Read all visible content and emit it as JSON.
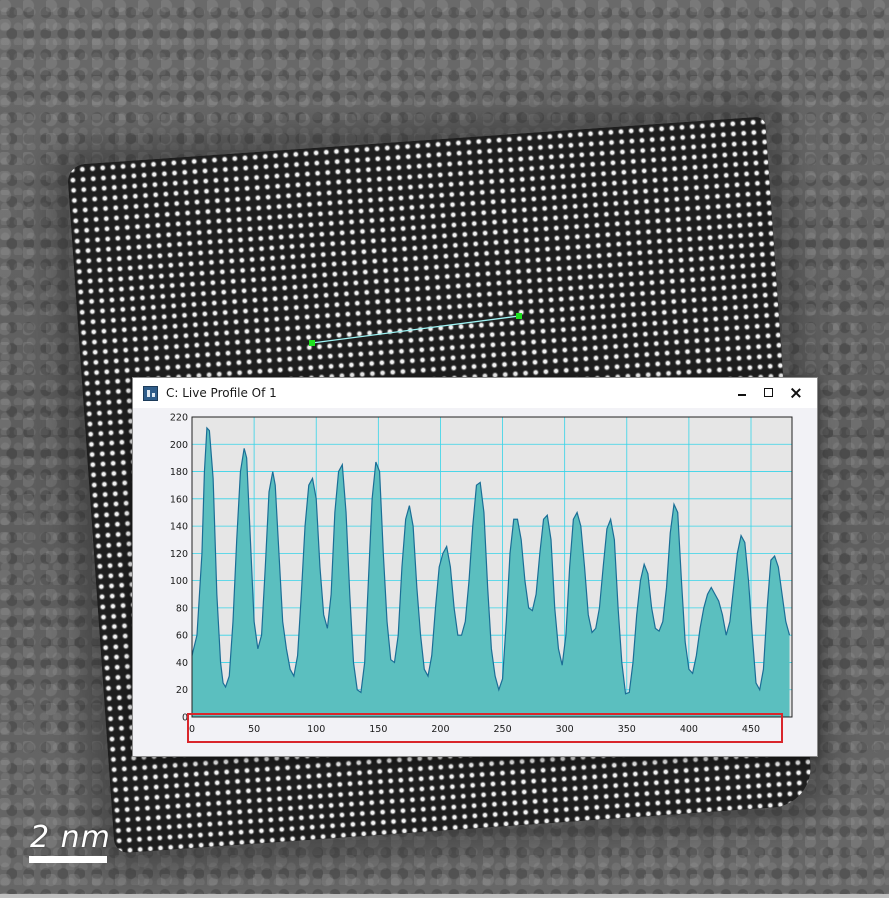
{
  "window": {
    "title": "C: Live Profile Of 1",
    "icon": "profile-app-icon"
  },
  "controls": {
    "minimize_icon": "minimize-icon",
    "maximize_icon": "maximize-icon",
    "close_icon": "close-icon"
  },
  "scale_bar": {
    "label": "2 nm"
  },
  "colors": {
    "fill": "#5bbfbf",
    "stroke": "#1b6e96",
    "grid": "#35d4e8",
    "plot_bg": "#e6e6e6",
    "highlight": "#d9262b",
    "line_endpoint": "#1ee01e",
    "profile_line": "#9ef2f2"
  },
  "chart_data": {
    "type": "area",
    "title": "",
    "xlabel": "",
    "ylabel": "",
    "xlim": [
      0,
      483
    ],
    "ylim": [
      0,
      220
    ],
    "x_ticks": [
      0,
      50,
      100,
      150,
      200,
      250,
      300,
      350,
      400,
      450
    ],
    "y_ticks": [
      0,
      20,
      40,
      60,
      80,
      100,
      120,
      140,
      160,
      180,
      200,
      220
    ],
    "grid": true,
    "x": [
      0,
      4,
      8,
      10,
      12,
      14,
      17,
      20,
      23,
      25,
      27,
      30,
      33,
      36,
      39,
      42,
      44,
      47,
      50,
      53,
      56,
      59,
      62,
      65,
      67,
      70,
      73,
      76,
      79,
      82,
      85,
      88,
      91,
      94,
      97,
      100,
      103,
      106,
      109,
      112,
      115,
      118,
      121,
      124,
      127,
      130,
      133,
      136,
      139,
      142,
      145,
      148,
      151,
      154,
      157,
      160,
      163,
      166,
      169,
      172,
      175,
      178,
      181,
      184,
      187,
      190,
      193,
      196,
      199,
      202,
      205,
      208,
      211,
      214,
      217,
      220,
      223,
      226,
      229,
      232,
      235,
      238,
      241,
      244,
      247,
      250,
      253,
      256,
      259,
      262,
      265,
      268,
      271,
      274,
      277,
      280,
      283,
      286,
      289,
      292,
      295,
      298,
      301,
      304,
      307,
      310,
      313,
      316,
      319,
      322,
      325,
      328,
      331,
      334,
      337,
      340,
      343,
      346,
      349,
      352,
      355,
      358,
      361,
      364,
      367,
      370,
      373,
      376,
      379,
      382,
      385,
      388,
      391,
      394,
      397,
      400,
      403,
      406,
      409,
      412,
      415,
      418,
      421,
      424,
      427,
      430,
      433,
      436,
      439,
      442,
      445,
      448,
      451,
      454,
      457,
      460,
      463,
      466,
      469,
      472,
      475,
      478,
      481
    ],
    "y": [
      45,
      60,
      120,
      180,
      212,
      210,
      175,
      90,
      40,
      25,
      22,
      30,
      70,
      130,
      180,
      197,
      190,
      130,
      70,
      50,
      60,
      110,
      165,
      180,
      170,
      120,
      70,
      50,
      35,
      30,
      45,
      90,
      140,
      170,
      175,
      160,
      110,
      75,
      65,
      90,
      150,
      180,
      185,
      150,
      90,
      40,
      20,
      18,
      40,
      100,
      160,
      187,
      180,
      120,
      70,
      42,
      40,
      60,
      110,
      145,
      155,
      140,
      95,
      60,
      35,
      30,
      45,
      80,
      110,
      120,
      125,
      110,
      80,
      60,
      60,
      70,
      100,
      140,
      170,
      172,
      150,
      95,
      50,
      30,
      20,
      28,
      70,
      120,
      145,
      145,
      130,
      100,
      80,
      78,
      90,
      120,
      145,
      148,
      130,
      80,
      50,
      38,
      60,
      110,
      145,
      150,
      140,
      110,
      75,
      62,
      65,
      80,
      110,
      138,
      145,
      130,
      80,
      40,
      17,
      18,
      40,
      75,
      100,
      112,
      105,
      80,
      65,
      63,
      70,
      95,
      135,
      156,
      150,
      100,
      55,
      35,
      32,
      45,
      65,
      80,
      90,
      95,
      90,
      85,
      75,
      60,
      70,
      95,
      120,
      133,
      128,
      100,
      60,
      25,
      20,
      35,
      80,
      115,
      118,
      110,
      90,
      70,
      60
    ]
  }
}
